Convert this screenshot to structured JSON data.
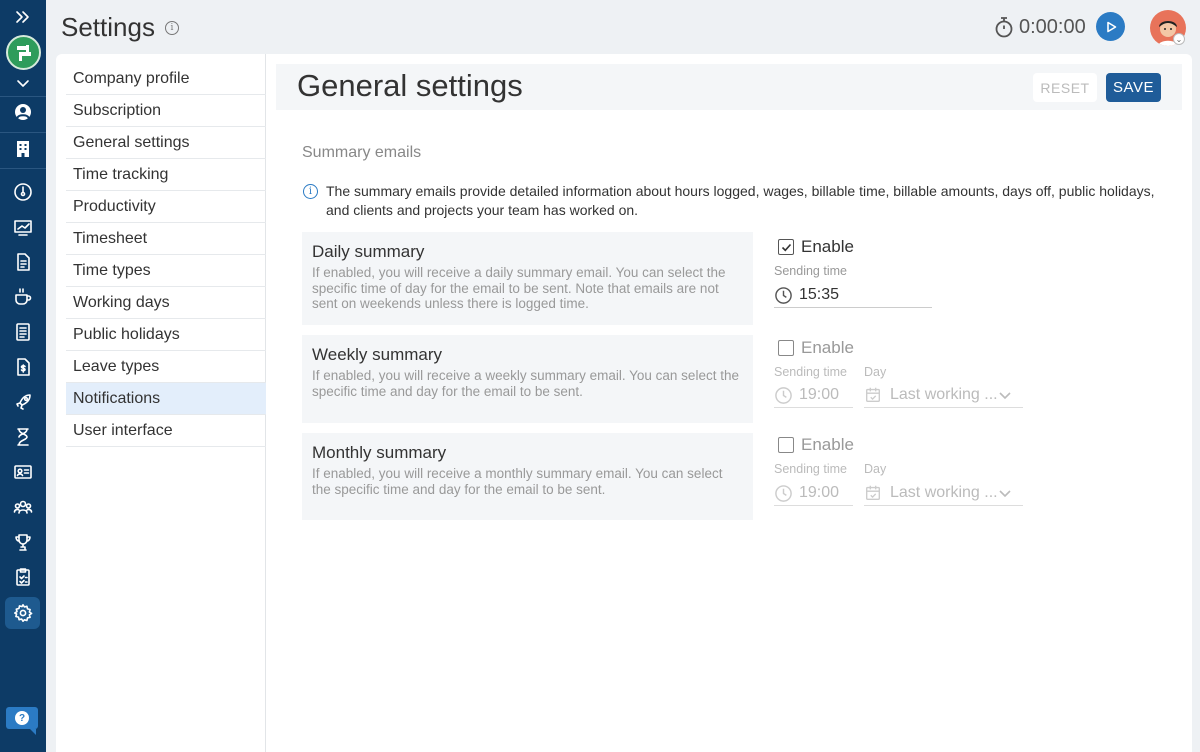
{
  "header": {
    "title": "Settings",
    "timer": "0:00:00"
  },
  "settings_menu": [
    {
      "label": "Company profile",
      "selected": false
    },
    {
      "label": "Subscription",
      "selected": false
    },
    {
      "label": "General settings",
      "selected": false
    },
    {
      "label": "Time tracking",
      "selected": false
    },
    {
      "label": "Productivity",
      "selected": false
    },
    {
      "label": "Timesheet",
      "selected": false
    },
    {
      "label": "Time types",
      "selected": false
    },
    {
      "label": "Working days",
      "selected": false
    },
    {
      "label": "Public holidays",
      "selected": false
    },
    {
      "label": "Leave types",
      "selected": false
    },
    {
      "label": "Notifications",
      "selected": true
    },
    {
      "label": "User interface",
      "selected": false
    }
  ],
  "content": {
    "title": "General settings",
    "reset_label": "RESET",
    "save_label": "SAVE",
    "section_title": "Summary emails",
    "notice": "The summary emails provide detailed information about hours logged, wages, billable time, billable amounts, days off, public holidays, and clients and projects your team has worked on."
  },
  "summaries": {
    "daily": {
      "title": "Daily summary",
      "description": "If enabled, you will receive a daily summary email. You can select the specific time of day for the email to be sent. Note that emails are not sent on weekends unless there is logged time.",
      "enable_label": "Enable",
      "enabled": true,
      "time_label": "Sending time",
      "time": "15:35"
    },
    "weekly": {
      "title": "Weekly summary",
      "description": "If enabled, you will receive a weekly summary email. You can select the specific time and day for the email to be sent.",
      "enable_label": "Enable",
      "enabled": false,
      "time_label": "Sending time",
      "time": "19:00",
      "day_label": "Day",
      "day": "Last working ..."
    },
    "monthly": {
      "title": "Monthly summary",
      "description": "If enabled, you will receive a monthly summary email. You can select the specific time and day for the email to be sent.",
      "enable_label": "Enable",
      "enabled": false,
      "time_label": "Sending time",
      "time": "19:00",
      "day_label": "Day",
      "day": "Last working ..."
    }
  },
  "rail_icons": [
    "expand-icon",
    "user-icon",
    "building-icon",
    "dashboard-icon",
    "chart-icon",
    "document-icon",
    "coffee-icon",
    "report-icon",
    "invoice-icon",
    "rocket-icon",
    "hourglass-icon",
    "id-card-icon",
    "team-icon",
    "trophy-icon",
    "clipboard-icon",
    "settings-icon",
    "help-icon"
  ],
  "colors": {
    "rail": "#0d3b66",
    "accent": "#1f5c99",
    "logo": "#2e9c5b",
    "selected_menu": "#e3eefb"
  }
}
